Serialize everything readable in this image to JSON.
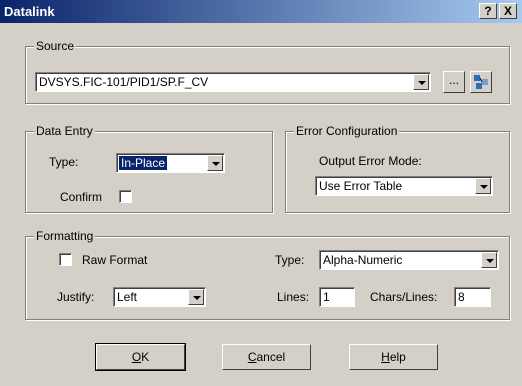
{
  "window": {
    "title": "Datalink",
    "help_glyph": "?",
    "close_glyph": "X"
  },
  "source": {
    "legend": "Source",
    "value": "DVSYS.FIC-101/PID1/SP.F_CV",
    "browse_label": "..."
  },
  "data_entry": {
    "legend": "Data Entry",
    "type_label": "Type:",
    "type_value": "In-Place",
    "confirm_label": "Confirm",
    "confirm_checked": false
  },
  "error_config": {
    "legend": "Error Configuration",
    "output_mode_label": "Output Error Mode:",
    "output_mode_value": "Use Error Table"
  },
  "formatting": {
    "legend": "Formatting",
    "raw_format_label": "Raw Format",
    "raw_format_checked": false,
    "type_label": "Type:",
    "type_value": "Alpha-Numeric",
    "justify_label": "Justify:",
    "justify_value": "Left",
    "lines_label": "Lines:",
    "lines_value": "1",
    "chars_label": "Chars/Lines:",
    "chars_value": "8"
  },
  "buttons": {
    "ok_first": "O",
    "ok_rest": "K",
    "cancel_first": "C",
    "cancel_rest": "ancel",
    "help_first": "H",
    "help_rest": "elp"
  },
  "colors": {
    "titlebar_start": "#0a246a",
    "titlebar_end": "#a6caf0",
    "face": "#d4d0c8"
  }
}
